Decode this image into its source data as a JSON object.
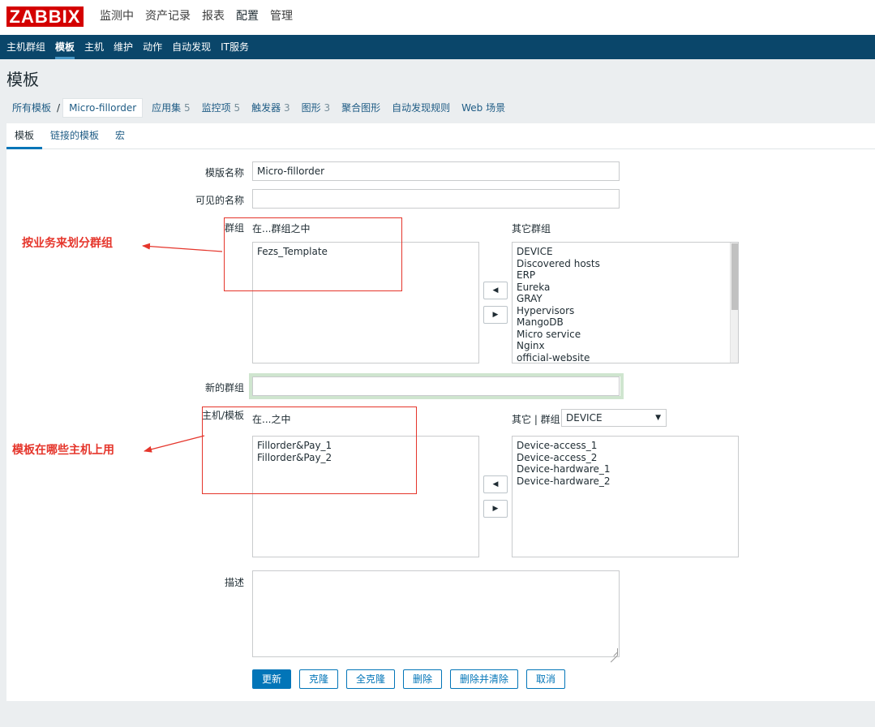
{
  "header": {
    "logo": "ZABBIX",
    "menu": [
      "监测中",
      "资产记录",
      "报表",
      "配置",
      "管理"
    ]
  },
  "subnav": {
    "items": [
      "主机群组",
      "模板",
      "主机",
      "维护",
      "动作",
      "自动发现",
      "IT服务"
    ]
  },
  "page": {
    "title": "模板"
  },
  "breadcrumb": {
    "all": "所有模板",
    "sep": "/",
    "current": "Micro-fillorder",
    "links": [
      {
        "label": "应用集",
        "count": "5"
      },
      {
        "label": "监控项",
        "count": "5"
      },
      {
        "label": "触发器",
        "count": "3"
      },
      {
        "label": "图形",
        "count": "3"
      },
      {
        "label": "聚合图形",
        "count": ""
      },
      {
        "label": "自动发现规则",
        "count": ""
      },
      {
        "label": "Web 场景",
        "count": ""
      }
    ]
  },
  "tabs": [
    "模板",
    "链接的模板",
    "宏"
  ],
  "form": {
    "template_name_label": "模版名称",
    "template_name_value": "Micro-fillorder",
    "visible_name_label": "可见的名称",
    "visible_name_value": "",
    "groups_label": "群组",
    "groups_in_label": "在...群组之中",
    "groups_in": [
      "Fezs_Template"
    ],
    "groups_other_label": "其它群组",
    "groups_other": [
      "DEVICE",
      "Discovered hosts",
      "ERP",
      "Eureka",
      "GRAY",
      "Hypervisors",
      "MangoDB",
      "Micro service",
      "Nginx",
      "official-website"
    ],
    "new_group_label": "新的群组",
    "new_group_value": "",
    "hosts_label": "主机/模板",
    "hosts_in_label": "在...之中",
    "hosts_in": [
      "Fillorder&Pay_1",
      "Fillorder&Pay_2"
    ],
    "hosts_other_label": "其它 | 群组",
    "hosts_group_selected": "DEVICE",
    "hosts_other": [
      "Device-access_1",
      "Device-access_2",
      "Device-hardware_1",
      "Device-hardware_2"
    ],
    "description_label": "描述",
    "description_value": "",
    "arrow_left": "◀",
    "arrow_right": "▶"
  },
  "buttons": {
    "update": "更新",
    "clone": "克隆",
    "full_clone": "全克隆",
    "delete": "删除",
    "delete_clear": "删除并清除",
    "cancel": "取消"
  },
  "annotations": {
    "groups_note": "按业务来划分群组",
    "hosts_note": "模板在哪些主机上用"
  },
  "colors": {
    "brand": "#d40000",
    "subnav_bg": "#0a466a",
    "link": "#1f5c85",
    "primary": "#0275b8",
    "annotation": "#e5352b"
  }
}
